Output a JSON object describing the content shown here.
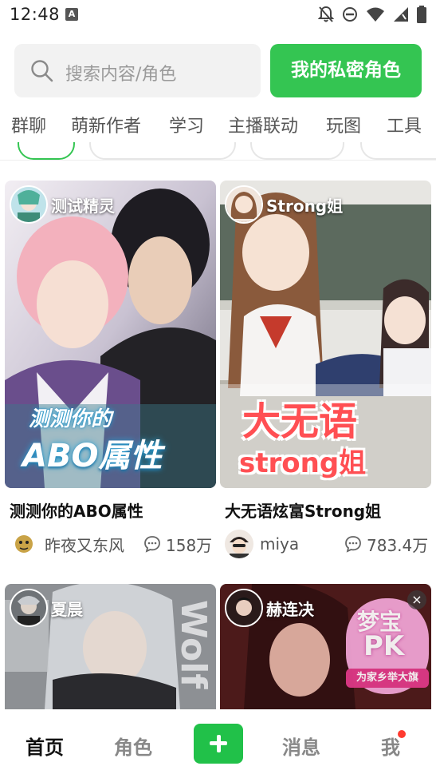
{
  "status_bar": {
    "time": "12:48",
    "left_icon": "A"
  },
  "search": {
    "placeholder": "搜索内容/角色",
    "private_button": "我的私密角色"
  },
  "categories": [
    "群聊",
    "萌新作者",
    "学习",
    "主播联动",
    "玩图",
    "工具"
  ],
  "cards": [
    {
      "author": "测试精灵",
      "title": "测测你的ABO属性",
      "creator": "昨夜又东风",
      "stat": "158万",
      "overlay_top": "测测你的",
      "overlay_bottom": "ABO属性"
    },
    {
      "author": "Strong姐",
      "title": "大无语炫富Strong姐",
      "creator": "miya",
      "stat": "783.4万",
      "overlay_top": "大无语",
      "overlay_bottom": "strong姐"
    },
    {
      "author": "夏晨",
      "overlay_side": "Wolf"
    },
    {
      "author": "赫连决",
      "promo_top": "梦宝",
      "promo_mid": "PK",
      "promo_bottom": "为家乡举大旗",
      "close": "×"
    }
  ],
  "bottom_nav": [
    "首页",
    "角色",
    "消息",
    "我"
  ],
  "colors": {
    "accent": "#34c552",
    "nav_add": "#21c149",
    "badge_red": "#ff3b30"
  },
  "icons": [
    "search-icon",
    "chat-bubble-icon",
    "plus-icon",
    "mute-icon",
    "wifi-icon",
    "signal-icon",
    "battery-icon",
    "dnd-icon",
    "close-icon"
  ]
}
